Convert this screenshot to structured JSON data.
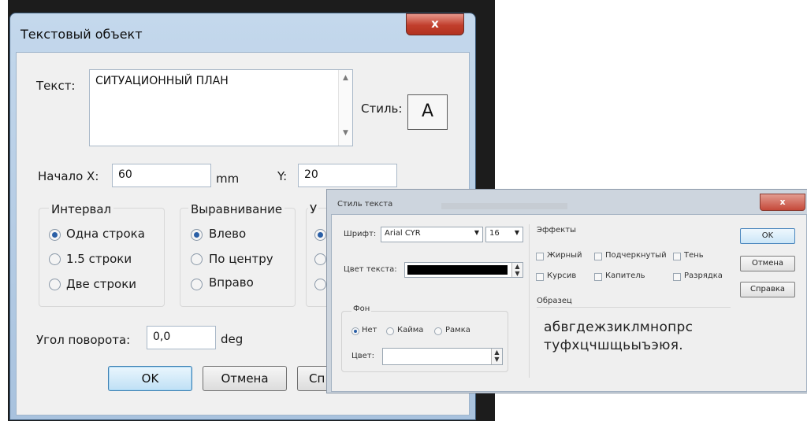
{
  "text_object_dialog": {
    "title": "Текстовый объект",
    "close_glyph": "x",
    "text_label": "Текст:",
    "text_value": "СИТУАЦИОННЫЙ ПЛАН",
    "style_label": "Стиль:",
    "style_glyph": "A",
    "start_x_label": "Начало X:",
    "start_x_value": "60",
    "unit_mm": "mm",
    "y_label": "Y:",
    "y_value": "20",
    "interval": {
      "title": "Интервал",
      "options": [
        "Одна строка",
        "1.5 строки",
        "Две строки"
      ],
      "selected": "Одна строка"
    },
    "align": {
      "title": "Выравнивание",
      "options": [
        "Влево",
        "По центру",
        "Вправо"
      ],
      "selected": "Влево"
    },
    "third_group_title_fragment": "У",
    "angle_label": "Угол поворота:",
    "angle_value": "0,0",
    "angle_unit": "deg",
    "ok_label": "OK",
    "cancel_label": "Отмена",
    "help_label_fragment": "Сп"
  },
  "text_style_dialog": {
    "title": "Стиль текста",
    "close_glyph": "x",
    "font_label": "Шрифт:",
    "font_value": "Arial CYR",
    "size_value": "16",
    "text_color_label": "Цвет текста:",
    "text_color_hex": "#000000",
    "background": {
      "title": "Фон",
      "options": [
        "Нет",
        "Кайма",
        "Рамка"
      ],
      "selected": "Нет",
      "color_label": "Цвет:"
    },
    "effects": {
      "title": "Эффекты",
      "items": [
        "Жирный",
        "Подчеркнутый",
        "Тень",
        "Курсив",
        "Капитель",
        "Разрядка"
      ]
    },
    "sample_title": "Образец",
    "sample_line1": "абвгдежзиклмнопрс",
    "sample_line2": "туфхцчшщьыъэюя.",
    "ok_label": "OK",
    "cancel_label": "Отмена",
    "help_label": "Справка"
  },
  "colors": {
    "selected_radio": "#2a5fa6",
    "close_button": "#c13e2c",
    "default_button": "#3c7fb1"
  }
}
